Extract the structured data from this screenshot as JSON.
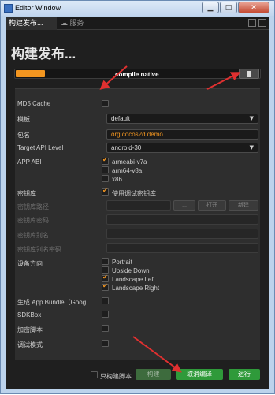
{
  "window": {
    "title": "Editor Window"
  },
  "titlebar_buttons": {
    "minimize": "▁",
    "maximize": "□",
    "close": "✕"
  },
  "tabs": [
    {
      "label": "构建发布...",
      "active": true
    },
    {
      "label": "服务",
      "active": false
    }
  ],
  "page": {
    "title": "构建发布..."
  },
  "progress": {
    "text": "compile native",
    "fraction": 0.12
  },
  "form": {
    "md5_cache": {
      "label": "MD5 Cache",
      "checked": false
    },
    "template": {
      "label": "模板",
      "value": "default"
    },
    "package_name": {
      "label": "包名",
      "value": "org.cocos2d.demo"
    },
    "target_api": {
      "label": "Target API Level",
      "value": "android-30"
    },
    "app_abi": {
      "label": "APP ABI",
      "options": [
        {
          "label": "armeabi-v7a",
          "checked": true
        },
        {
          "label": "arm64-v8a",
          "checked": false
        },
        {
          "label": "x86",
          "checked": false
        }
      ]
    },
    "keystore": {
      "label": "密钥库",
      "use_debug_label": "使用调试密钥库",
      "checked": true
    },
    "keystore_path": {
      "label": "密钥库路径",
      "btn_dots": "...",
      "btn_open": "打开",
      "btn_new": "新建"
    },
    "keystore_password": {
      "label": "密钥库密码"
    },
    "keystore_alias": {
      "label": "密钥库别名"
    },
    "keystore_alias_password": {
      "label": "密钥库别名密码"
    },
    "orientation": {
      "label": "设备方向",
      "options": [
        {
          "label": "Portrait",
          "checked": false
        },
        {
          "label": "Upside Down",
          "checked": false
        },
        {
          "label": "Landscape Left",
          "checked": true
        },
        {
          "label": "Landscape Right",
          "checked": true
        }
      ]
    },
    "app_bundle": {
      "label": "生成 App Bundle（Goog...",
      "checked": false
    },
    "sdkbox": {
      "label": "SDKBox",
      "checked": false
    },
    "encrypt_js": {
      "label": "加密脚本",
      "checked": false
    },
    "debug_mode": {
      "label": "调试模式",
      "checked": false
    }
  },
  "footer": {
    "build_script_only": {
      "label": "只构建脚本",
      "checked": false
    },
    "build_button": "构建",
    "cancel_compile_button": "取消编译",
    "run_button": "运行"
  },
  "colors": {
    "accent": "#f39620",
    "build_green": "#3a8a3a",
    "annotation_red": "#e03030"
  }
}
